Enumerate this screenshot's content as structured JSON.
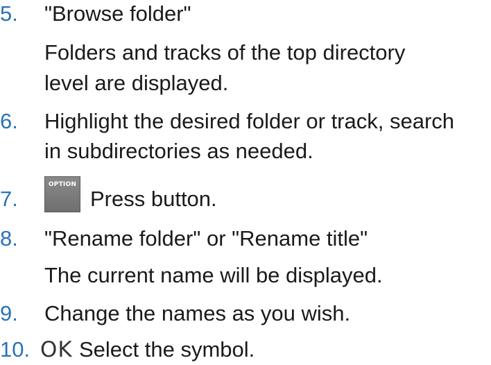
{
  "steps": [
    {
      "number": "5.",
      "text": "\"Browse folder\"",
      "detail_lines": [
        "Folders and tracks of the top directory",
        "level are displayed."
      ]
    },
    {
      "number": "6.",
      "lines": [
        "Highlight the desired folder or track, search",
        "in subdirectories as needed."
      ]
    },
    {
      "number": "7.",
      "button_label": "OPTION",
      "text": "Press button."
    },
    {
      "number": "8.",
      "text": "\"Rename folder\" or \"Rename title\"",
      "detail_lines": [
        "The current name will be displayed."
      ]
    },
    {
      "number": "9.",
      "text": "Change the names as you wish."
    },
    {
      "number": "10.",
      "symbol": "OK",
      "text": "Select the symbol."
    }
  ],
  "colors": {
    "step_number": "#2a72b8",
    "text": "#1a1a1a"
  }
}
